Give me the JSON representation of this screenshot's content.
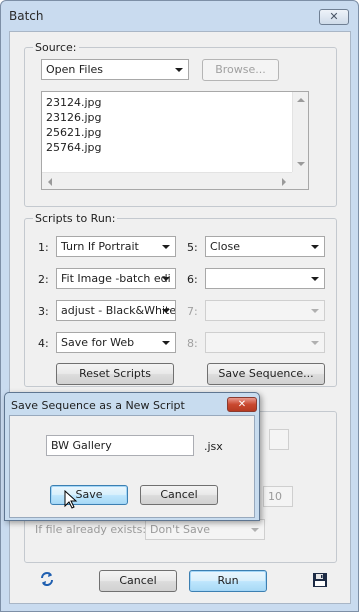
{
  "window": {
    "title": "Batch",
    "close_glyph": "✕"
  },
  "source": {
    "label": "Source:",
    "selected": "Open Files",
    "browse_label": "Browse...",
    "files": [
      "23124.jpg",
      "23126.jpg",
      "25621.jpg",
      "25764.jpg"
    ]
  },
  "scripts": {
    "label": "Scripts to Run:",
    "slots": [
      {
        "num": "1:",
        "value": "Turn If Portrait",
        "enabled": true
      },
      {
        "num": "2:",
        "value": "Fit Image -batch edi",
        "enabled": true
      },
      {
        "num": "3:",
        "value": "adjust - Black&White",
        "enabled": true
      },
      {
        "num": "4:",
        "value": "Save for Web",
        "enabled": true
      },
      {
        "num": "5:",
        "value": "Close",
        "enabled": true
      },
      {
        "num": "6:",
        "value": "",
        "enabled": true
      },
      {
        "num": "7:",
        "value": "",
        "enabled": false
      },
      {
        "num": "8:",
        "value": "",
        "enabled": false
      }
    ],
    "reset_label": "Reset Scripts",
    "save_sequence_label": "Save Sequence..."
  },
  "destination": {
    "number_value": "10",
    "if_exists_label": "If file already exists:",
    "if_exists_value": "Don't Save"
  },
  "footer": {
    "cancel_label": "Cancel",
    "run_label": "Run",
    "refresh_icon": "refresh-icon",
    "save_icon": "floppy-disk-icon"
  },
  "save_dialog": {
    "title": "Save Sequence as a New Script",
    "name_value": "BW Gallery",
    "extension": ".jsx",
    "save_label": "Save",
    "cancel_label": "Cancel",
    "close_glyph": "✕"
  }
}
